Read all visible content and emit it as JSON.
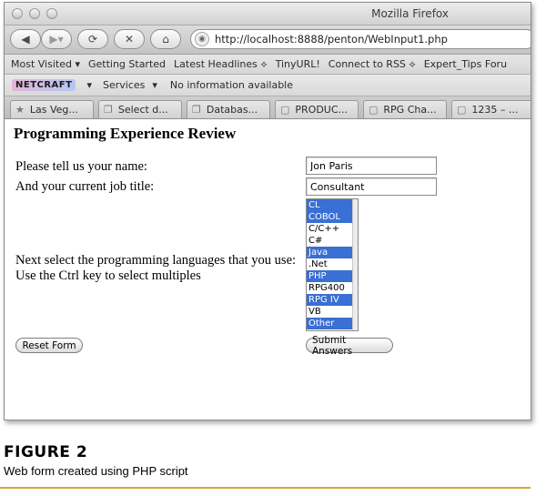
{
  "browser": {
    "window_title": "Mozilla Firefox",
    "url": "http://localhost:8888/penton/WebInput1.php",
    "bookmarks": [
      "Most Visited ▾",
      "Getting Started",
      "Latest Headlines ⟡",
      "TinyURL!",
      "Connect to RSS ⟡",
      "Expert_Tips Foru"
    ],
    "netcraft": {
      "logo": "NETCRAFT",
      "menu": "▾",
      "services": "Services",
      "services_menu": "▾",
      "info": "No information available"
    },
    "tabs": [
      {
        "label": "Las Veg...",
        "icon": "star-icon"
      },
      {
        "label": "Select d...",
        "icon": "page-icon"
      },
      {
        "label": "Databas...",
        "icon": "page-icon"
      },
      {
        "label": "PRODUC...",
        "icon": "doc-icon"
      },
      {
        "label": "RPG Cha...",
        "icon": "doc-icon"
      },
      {
        "label": "1235 – ...",
        "icon": "doc-icon"
      }
    ]
  },
  "form": {
    "heading": "Programming Experience Review",
    "name_label": "Please tell us your name:",
    "name_value": "Jon Paris",
    "job_label": "And your current job title:",
    "job_value": "Consultant",
    "lang_label1": "Next select the programming languages that you use:",
    "lang_label2": "Use the Ctrl key to select multiples",
    "languages": [
      {
        "label": "CL",
        "selected": true
      },
      {
        "label": "COBOL",
        "selected": true
      },
      {
        "label": "C/C++",
        "selected": false
      },
      {
        "label": "C#",
        "selected": false
      },
      {
        "label": "Java",
        "selected": true
      },
      {
        "label": ".Net",
        "selected": false
      },
      {
        "label": "PHP",
        "selected": true
      },
      {
        "label": "RPG400",
        "selected": false
      },
      {
        "label": "RPG IV",
        "selected": true
      },
      {
        "label": "VB",
        "selected": false
      },
      {
        "label": "Other",
        "selected": true
      }
    ],
    "reset_label": "Reset Form",
    "submit_label": "Submit Answers"
  },
  "figure": {
    "title": "FIGURE 2",
    "caption": "Web form created using PHP script"
  },
  "colors": {
    "selection": "#3a6fd3",
    "caption_rule": "#d9a43a"
  }
}
